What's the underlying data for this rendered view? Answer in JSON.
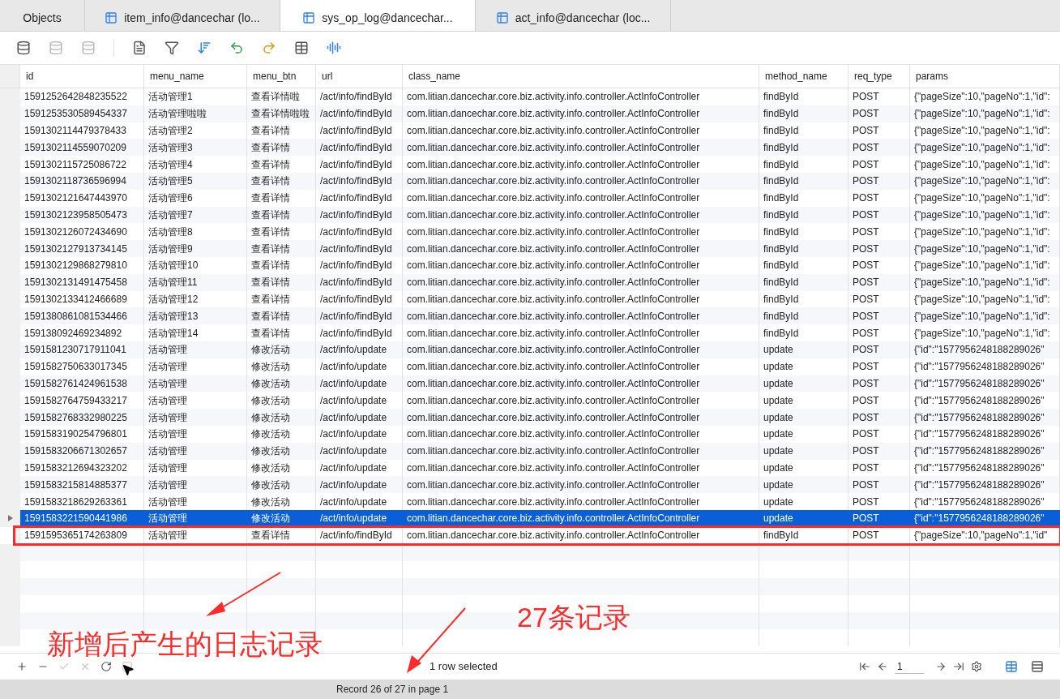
{
  "tabs": [
    {
      "label": "Objects",
      "kind": "objects",
      "selected": false
    },
    {
      "label": "item_info@dancechar (lo...",
      "kind": "table-edit",
      "selected": false
    },
    {
      "label": "sys_op_log@dancechar...",
      "kind": "table",
      "selected": true
    },
    {
      "label": "act_info@dancechar (loc...",
      "kind": "table",
      "selected": false
    }
  ],
  "table": {
    "columns": [
      "id",
      "menu_name",
      "menu_btn",
      "url",
      "class_name",
      "method_name",
      "req_type",
      "params"
    ],
    "rows": [
      {
        "cells": [
          "1591252642848235522",
          "活动管理1",
          "查看详情啦",
          "/act/info/findById",
          "com.litian.dancechar.core.biz.activity.info.controller.ActInfoController",
          "findById",
          "POST",
          "{\"pageSize\":10,\"pageNo\":1,\"id\":"
        ],
        "selected": false,
        "highlighted": false
      },
      {
        "cells": [
          "1591253530589454337",
          "活动管理啦啦",
          "查看详情啦啦",
          "/act/info/findById",
          "com.litian.dancechar.core.biz.activity.info.controller.ActInfoController",
          "findById",
          "POST",
          "{\"pageSize\":10,\"pageNo\":1,\"id\":"
        ],
        "selected": false,
        "highlighted": false
      },
      {
        "cells": [
          "1591302114479378433",
          "活动管理2",
          "查看详情",
          "/act/info/findById",
          "com.litian.dancechar.core.biz.activity.info.controller.ActInfoController",
          "findById",
          "POST",
          "{\"pageSize\":10,\"pageNo\":1,\"id\":"
        ],
        "selected": false,
        "highlighted": false
      },
      {
        "cells": [
          "1591302114559070209",
          "活动管理3",
          "查看详情",
          "/act/info/findById",
          "com.litian.dancechar.core.biz.activity.info.controller.ActInfoController",
          "findById",
          "POST",
          "{\"pageSize\":10,\"pageNo\":1,\"id\":"
        ],
        "selected": false,
        "highlighted": false
      },
      {
        "cells": [
          "1591302115725086722",
          "活动管理4",
          "查看详情",
          "/act/info/findById",
          "com.litian.dancechar.core.biz.activity.info.controller.ActInfoController",
          "findById",
          "POST",
          "{\"pageSize\":10,\"pageNo\":1,\"id\":"
        ],
        "selected": false,
        "highlighted": false
      },
      {
        "cells": [
          "1591302118736596994",
          "活动管理5",
          "查看详情",
          "/act/info/findById",
          "com.litian.dancechar.core.biz.activity.info.controller.ActInfoController",
          "findById",
          "POST",
          "{\"pageSize\":10,\"pageNo\":1,\"id\":"
        ],
        "selected": false,
        "highlighted": false
      },
      {
        "cells": [
          "1591302121647443970",
          "活动管理6",
          "查看详情",
          "/act/info/findById",
          "com.litian.dancechar.core.biz.activity.info.controller.ActInfoController",
          "findById",
          "POST",
          "{\"pageSize\":10,\"pageNo\":1,\"id\":"
        ],
        "selected": false,
        "highlighted": false
      },
      {
        "cells": [
          "1591302123958505473",
          "活动管理7",
          "查看详情",
          "/act/info/findById",
          "com.litian.dancechar.core.biz.activity.info.controller.ActInfoController",
          "findById",
          "POST",
          "{\"pageSize\":10,\"pageNo\":1,\"id\":"
        ],
        "selected": false,
        "highlighted": false
      },
      {
        "cells": [
          "1591302126072434690",
          "活动管理8",
          "查看详情",
          "/act/info/findById",
          "com.litian.dancechar.core.biz.activity.info.controller.ActInfoController",
          "findById",
          "POST",
          "{\"pageSize\":10,\"pageNo\":1,\"id\":"
        ],
        "selected": false,
        "highlighted": false
      },
      {
        "cells": [
          "1591302127913734145",
          "活动管理9",
          "查看详情",
          "/act/info/findById",
          "com.litian.dancechar.core.biz.activity.info.controller.ActInfoController",
          "findById",
          "POST",
          "{\"pageSize\":10,\"pageNo\":1,\"id\":"
        ],
        "selected": false,
        "highlighted": false
      },
      {
        "cells": [
          "1591302129868279810",
          "活动管理10",
          "查看详情",
          "/act/info/findById",
          "com.litian.dancechar.core.biz.activity.info.controller.ActInfoController",
          "findById",
          "POST",
          "{\"pageSize\":10,\"pageNo\":1,\"id\":"
        ],
        "selected": false,
        "highlighted": false
      },
      {
        "cells": [
          "1591302131491475458",
          "活动管理11",
          "查看详情",
          "/act/info/findById",
          "com.litian.dancechar.core.biz.activity.info.controller.ActInfoController",
          "findById",
          "POST",
          "{\"pageSize\":10,\"pageNo\":1,\"id\":"
        ],
        "selected": false,
        "highlighted": false
      },
      {
        "cells": [
          "1591302133412466689",
          "活动管理12",
          "查看详情",
          "/act/info/findById",
          "com.litian.dancechar.core.biz.activity.info.controller.ActInfoController",
          "findById",
          "POST",
          "{\"pageSize\":10,\"pageNo\":1,\"id\":"
        ],
        "selected": false,
        "highlighted": false
      },
      {
        "cells": [
          "1591380861081534466",
          "活动管理13",
          "查看详情",
          "/act/info/findById",
          "com.litian.dancechar.core.biz.activity.info.controller.ActInfoController",
          "findById",
          "POST",
          "{\"pageSize\":10,\"pageNo\":1,\"id\":"
        ],
        "selected": false,
        "highlighted": false
      },
      {
        "cells": [
          "159138092469234892",
          "活动管理14",
          "查看详情",
          "/act/info/findById",
          "com.litian.dancechar.core.biz.activity.info.controller.ActInfoController",
          "findById",
          "POST",
          "{\"pageSize\":10,\"pageNo\":1,\"id\":"
        ],
        "selected": false,
        "highlighted": false
      },
      {
        "cells": [
          "1591581230717911041",
          "活动管理",
          "修改活动",
          "/act/info/update",
          "com.litian.dancechar.core.biz.activity.info.controller.ActInfoController",
          "update",
          "POST",
          "{\"id\":\"1577956248188289026\""
        ],
        "selected": false,
        "highlighted": false
      },
      {
        "cells": [
          "1591582750633017345",
          "活动管理",
          "修改活动",
          "/act/info/update",
          "com.litian.dancechar.core.biz.activity.info.controller.ActInfoController",
          "update",
          "POST",
          "{\"id\":\"1577956248188289026\""
        ],
        "selected": false,
        "highlighted": false
      },
      {
        "cells": [
          "1591582761424961538",
          "活动管理",
          "修改活动",
          "/act/info/update",
          "com.litian.dancechar.core.biz.activity.info.controller.ActInfoController",
          "update",
          "POST",
          "{\"id\":\"1577956248188289026\""
        ],
        "selected": false,
        "highlighted": false
      },
      {
        "cells": [
          "1591582764759433217",
          "活动管理",
          "修改活动",
          "/act/info/update",
          "com.litian.dancechar.core.biz.activity.info.controller.ActInfoController",
          "update",
          "POST",
          "{\"id\":\"1577956248188289026\""
        ],
        "selected": false,
        "highlighted": false
      },
      {
        "cells": [
          "1591582768332980225",
          "活动管理",
          "修改活动",
          "/act/info/update",
          "com.litian.dancechar.core.biz.activity.info.controller.ActInfoController",
          "update",
          "POST",
          "{\"id\":\"1577956248188289026\""
        ],
        "selected": false,
        "highlighted": false
      },
      {
        "cells": [
          "1591583190254796801",
          "活动管理",
          "修改活动",
          "/act/info/update",
          "com.litian.dancechar.core.biz.activity.info.controller.ActInfoController",
          "update",
          "POST",
          "{\"id\":\"1577956248188289026\""
        ],
        "selected": false,
        "highlighted": false
      },
      {
        "cells": [
          "1591583206671302657",
          "活动管理",
          "修改活动",
          "/act/info/update",
          "com.litian.dancechar.core.biz.activity.info.controller.ActInfoController",
          "update",
          "POST",
          "{\"id\":\"1577956248188289026\""
        ],
        "selected": false,
        "highlighted": false
      },
      {
        "cells": [
          "1591583212694323202",
          "活动管理",
          "修改活动",
          "/act/info/update",
          "com.litian.dancechar.core.biz.activity.info.controller.ActInfoController",
          "update",
          "POST",
          "{\"id\":\"1577956248188289026\""
        ],
        "selected": false,
        "highlighted": false
      },
      {
        "cells": [
          "1591583215814885377",
          "活动管理",
          "修改活动",
          "/act/info/update",
          "com.litian.dancechar.core.biz.activity.info.controller.ActInfoController",
          "update",
          "POST",
          "{\"id\":\"1577956248188289026\""
        ],
        "selected": false,
        "highlighted": false
      },
      {
        "cells": [
          "1591583218629263361",
          "活动管理",
          "修改活动",
          "/act/info/update",
          "com.litian.dancechar.core.biz.activity.info.controller.ActInfoController",
          "update",
          "POST",
          "{\"id\":\"1577956248188289026\""
        ],
        "selected": false,
        "highlighted": false
      },
      {
        "cells": [
          "1591583221590441986",
          "活动管理",
          "修改活动",
          "/act/info/update",
          "com.litian.dancechar.core.biz.activity.info.controller.ActInfoController",
          "update",
          "POST",
          "{\"id\":\"1577956248188289026\""
        ],
        "selected": true,
        "highlighted": false
      },
      {
        "cells": [
          "1591595365174263809",
          "活动管理",
          "查看详情",
          "/act/info/findById",
          "com.litian.dancechar.core.biz.activity.info.controller.ActInfoController",
          "findById",
          "POST",
          "{\"pageSize\":10,\"pageNo\":1,\"id\""
        ],
        "selected": false,
        "highlighted": true
      }
    ]
  },
  "bottom_toolbar": {
    "buttons": [
      {
        "kind": "add",
        "disabled": false
      },
      {
        "kind": "remove",
        "disabled": false
      },
      {
        "kind": "apply",
        "disabled": true
      },
      {
        "kind": "discard",
        "disabled": true
      },
      {
        "kind": "refresh",
        "disabled": false
      },
      {
        "kind": "stop",
        "disabled": true
      }
    ],
    "selection_text": "1 row selected",
    "page": "1"
  },
  "status_bar": "Record 26 of 27 in page 1",
  "annotations": [
    {
      "text": "新增后产生的日志记录"
    },
    {
      "text": "27条记录"
    }
  ]
}
